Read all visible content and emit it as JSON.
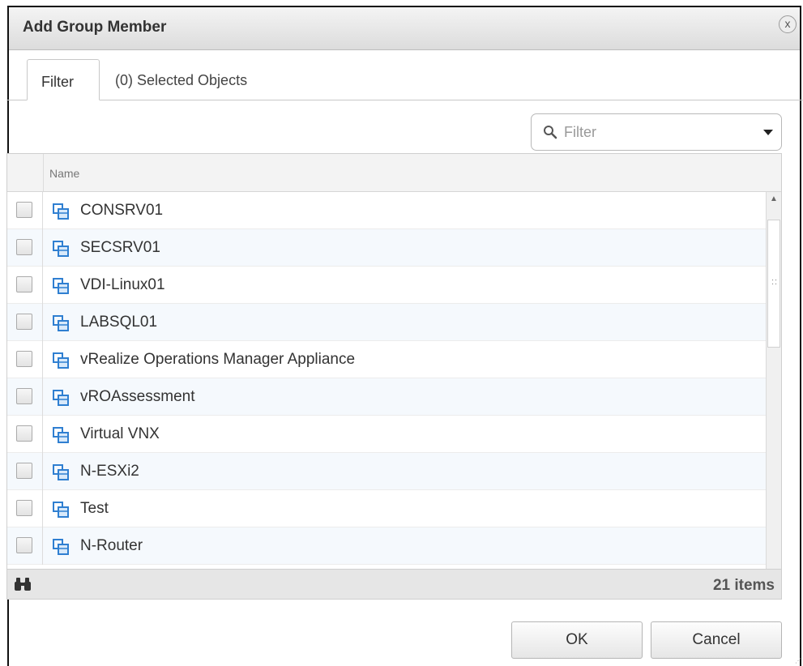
{
  "dialog": {
    "title": "Add Group Member",
    "close_label": "x"
  },
  "tabs": [
    {
      "label": "Filter"
    },
    {
      "label": "(0) Selected Objects"
    }
  ],
  "filter": {
    "placeholder": "Filter"
  },
  "grid": {
    "column_header": "Name",
    "rows": [
      {
        "name": "CONSRV01"
      },
      {
        "name": "SECSRV01"
      },
      {
        "name": "VDI-Linux01"
      },
      {
        "name": "LABSQL01"
      },
      {
        "name": "vRealize Operations Manager Appliance"
      },
      {
        "name": "vROAssessment"
      },
      {
        "name": "Virtual VNX"
      },
      {
        "name": "N-ESXi2"
      },
      {
        "name": "Test"
      },
      {
        "name": "N-Router"
      }
    ],
    "item_count": "21 items"
  },
  "buttons": {
    "ok": "OK",
    "cancel": "Cancel"
  },
  "colors": {
    "vm_icon": "#2f7fd1",
    "titlebar": "#dcdcdc"
  }
}
